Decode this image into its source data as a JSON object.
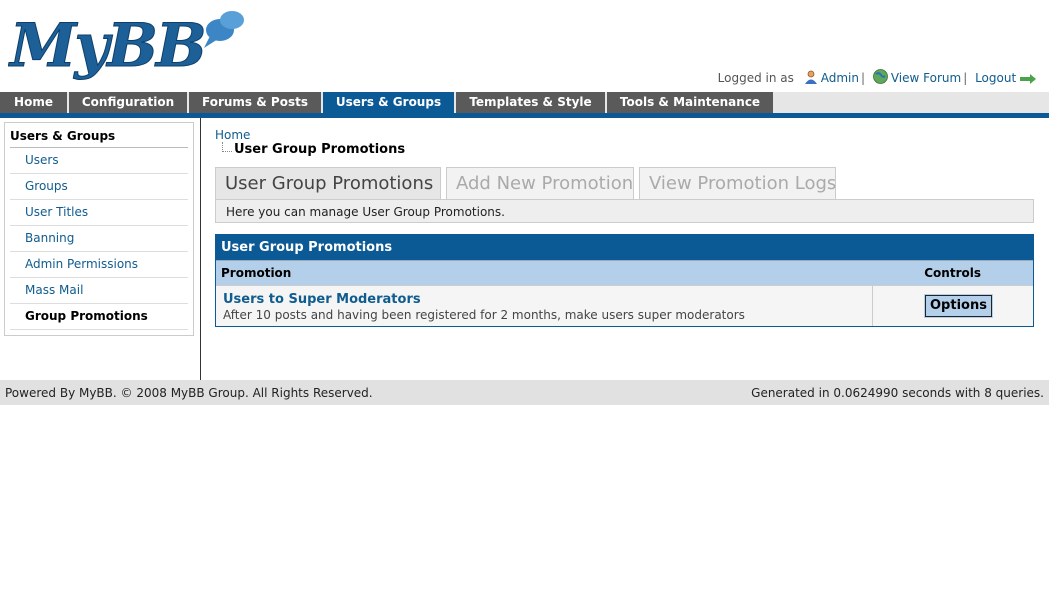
{
  "logo": {
    "text": "MyBB"
  },
  "welcome": {
    "prefix": "Logged in as",
    "user": "Admin",
    "view_forum": "View Forum",
    "logout": "Logout",
    "separator": "|"
  },
  "nav": {
    "tabs": [
      {
        "label": "Home"
      },
      {
        "label": "Configuration"
      },
      {
        "label": "Forums & Posts"
      },
      {
        "label": "Users & Groups"
      },
      {
        "label": "Templates & Style"
      },
      {
        "label": "Tools & Maintenance"
      }
    ],
    "active": "Users & Groups"
  },
  "sidebar": {
    "title": "Users & Groups",
    "items": [
      {
        "label": "Users"
      },
      {
        "label": "Groups"
      },
      {
        "label": "User Titles"
      },
      {
        "label": "Banning"
      },
      {
        "label": "Admin Permissions"
      },
      {
        "label": "Mass Mail"
      },
      {
        "label": "Group Promotions"
      }
    ],
    "active": "Group Promotions"
  },
  "breadcrumb": {
    "home": "Home",
    "current": "User Group Promotions"
  },
  "page_tabs": [
    {
      "label": "User Group Promotions"
    },
    {
      "label": "Add New Promotion"
    },
    {
      "label": "View Promotion Logs"
    }
  ],
  "description": "Here you can manage User Group Promotions.",
  "table": {
    "title": "User Group Promotions",
    "columns": [
      "Promotion",
      "Controls"
    ],
    "rows": [
      {
        "name": "Users to Super Moderators",
        "description": "After 10 posts and having been registered for 2 months, make users super moderators",
        "button": "Options"
      }
    ]
  },
  "footer": {
    "left": "Powered By MyBB. © 2008 MyBB Group. All Rights Reserved.",
    "right": "Generated in 0.0624990 seconds with 8 queries."
  },
  "colors": {
    "brand_blue": "#0b5a96",
    "tab_gray": "#5a5a5a",
    "link": "#0f5c8e",
    "header_row": "#b3cfe9"
  }
}
